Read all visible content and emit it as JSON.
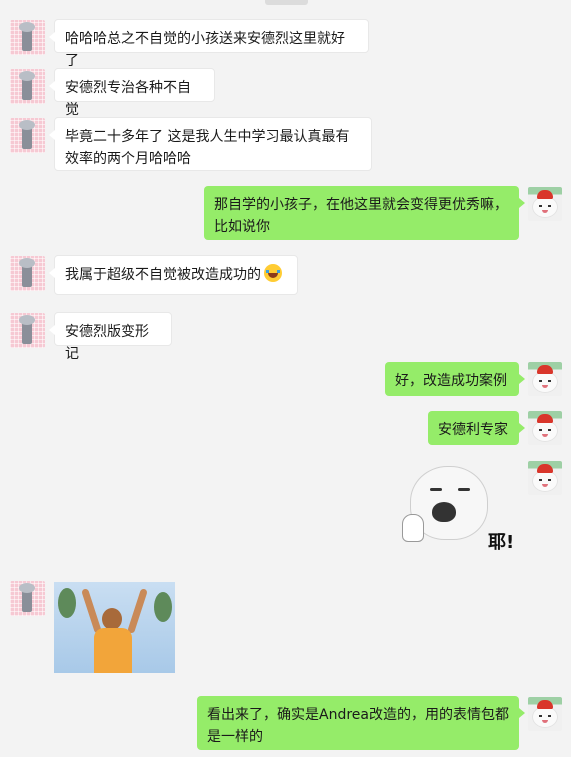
{
  "messages": [
    {
      "side": "left",
      "text": "哈哈哈总之不自觉的小孩送来安德烈这里就好了"
    },
    {
      "side": "left",
      "text": "安德烈专治各种不自觉"
    },
    {
      "side": "left",
      "text": "毕竟二十多年了 这是我人生中学习最认真最有效率的两个月哈哈哈"
    },
    {
      "side": "right",
      "text": "那自学的小孩子，在他这里就会变得更优秀嘛，比如说你"
    },
    {
      "side": "left",
      "text": "我属于超级不自觉被改造成功的",
      "emoji": "laughing-crying-emoji"
    },
    {
      "side": "left",
      "text": "安德烈版变形记"
    },
    {
      "side": "right",
      "text": "好，改造成功案例"
    },
    {
      "side": "right",
      "text": "安德利专家"
    },
    {
      "side": "right",
      "type": "sticker",
      "caption": "耶!",
      "icon": "cat-face-sticker"
    },
    {
      "side": "left",
      "type": "image",
      "icon": "celebrating-man-photo"
    },
    {
      "side": "right",
      "text": "看出来了，确实是Andrea改造的，用的表情包都是一样的"
    }
  ],
  "colors": {
    "background": "#f3f3f3",
    "left_bubble": "#ffffff",
    "right_bubble": "#95ec69"
  }
}
